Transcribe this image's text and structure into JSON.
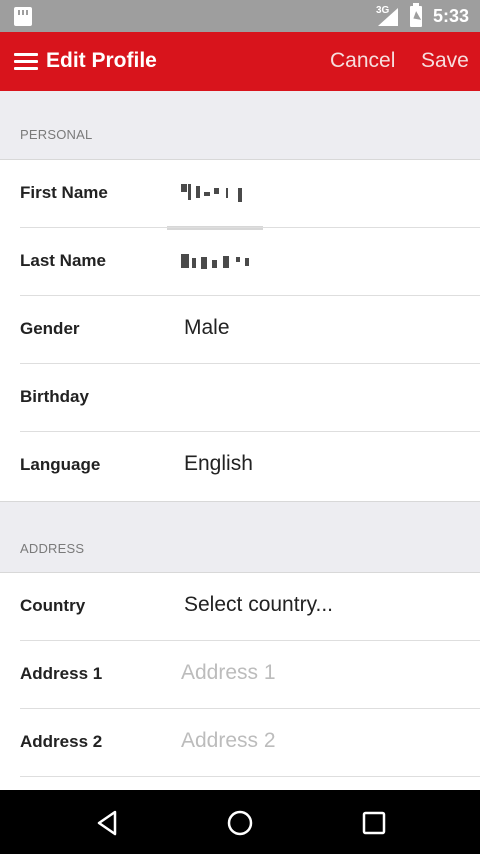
{
  "status_bar": {
    "network": "3G",
    "time": "5:33"
  },
  "app_bar": {
    "title": "Edit Profile",
    "cancel_label": "Cancel",
    "save_label": "Save"
  },
  "sections": {
    "personal": {
      "heading": "PERSONAL",
      "fields": {
        "first_name": {
          "label": "First Name"
        },
        "last_name": {
          "label": "Last Name"
        },
        "gender": {
          "label": "Gender",
          "value": "Male"
        },
        "birthday": {
          "label": "Birthday",
          "value": ""
        },
        "language": {
          "label": "Language",
          "value": "English"
        }
      }
    },
    "address": {
      "heading": "ADDRESS",
      "fields": {
        "country": {
          "label": "Country",
          "value": "Select country..."
        },
        "address1": {
          "label": "Address 1",
          "placeholder": "Address 1"
        },
        "address2": {
          "label": "Address 2",
          "placeholder": "Address 2"
        }
      }
    }
  },
  "icons": {
    "menu": "hamburger-menu-icon",
    "back": "back-icon",
    "home": "home-icon",
    "recents": "recents-icon"
  },
  "colors": {
    "accent": "#d8141c",
    "status_bar": "#9e9e9e",
    "section_background": "#ededf1"
  }
}
